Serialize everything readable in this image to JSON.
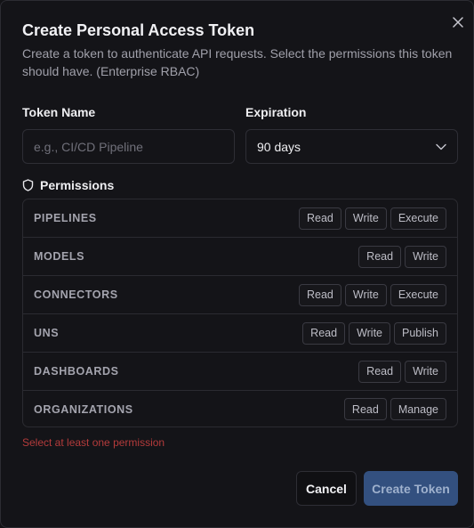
{
  "dialog": {
    "title": "Create Personal Access Token",
    "description": "Create a token to authenticate API requests. Select the permissions this token should have. (Enterprise RBAC)",
    "close_icon": "close-icon"
  },
  "token_name": {
    "label": "Token Name",
    "value": "",
    "placeholder": "e.g., CI/CD Pipeline"
  },
  "expiration": {
    "label": "Expiration",
    "value": "90 days",
    "icon": "chevron-down-icon"
  },
  "permissions": {
    "label": "Permissions",
    "icon": "shield-icon",
    "rows": [
      {
        "name": "PIPELINES",
        "actions": [
          "Read",
          "Write",
          "Execute"
        ]
      },
      {
        "name": "MODELS",
        "actions": [
          "Read",
          "Write"
        ]
      },
      {
        "name": "CONNECTORS",
        "actions": [
          "Read",
          "Write",
          "Execute"
        ]
      },
      {
        "name": "UNS",
        "actions": [
          "Read",
          "Write",
          "Publish"
        ]
      },
      {
        "name": "DASHBOARDS",
        "actions": [
          "Read",
          "Write"
        ]
      },
      {
        "name": "ORGANIZATIONS",
        "actions": [
          "Read",
          "Manage"
        ]
      }
    ]
  },
  "error_message": "Select at least one permission",
  "buttons": {
    "cancel": "Cancel",
    "create": "Create Token"
  },
  "colors": {
    "background": "#141418",
    "primary_disabled": "#33507f",
    "error": "#b43b3b"
  }
}
